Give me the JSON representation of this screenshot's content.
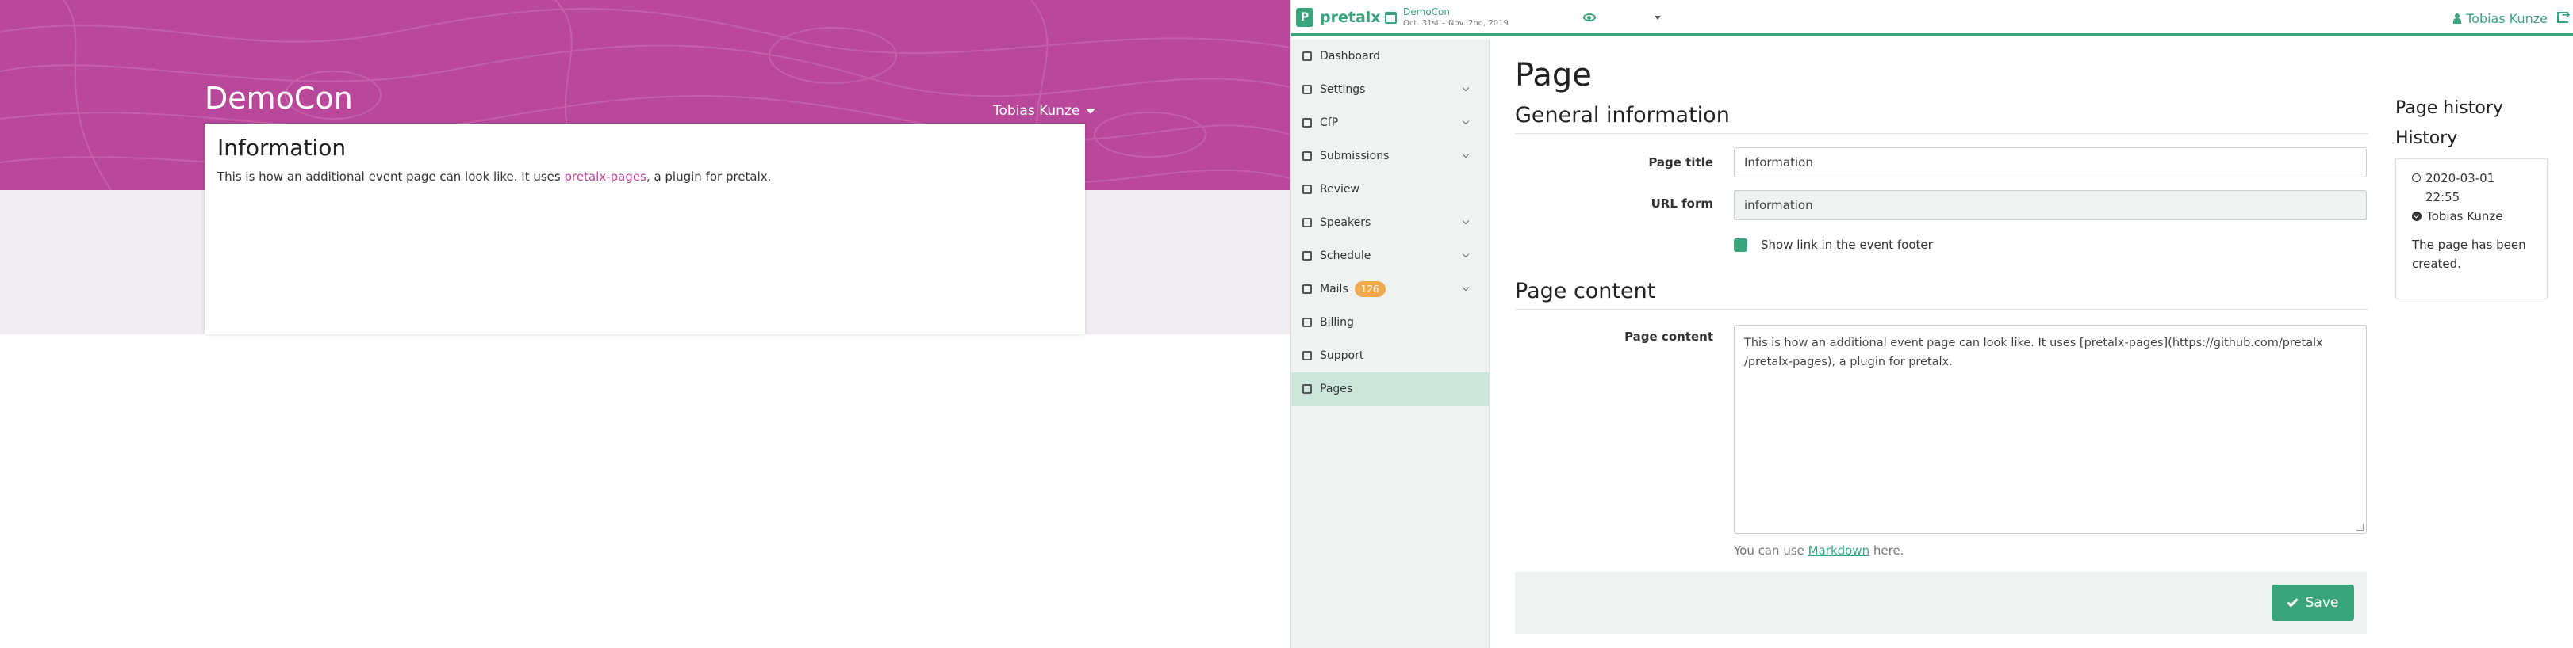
{
  "preview": {
    "event_title": "DemoCon",
    "user_name": "Tobias Kunze",
    "page_title": "Information",
    "body_before": "This is how an additional event page can look like. It uses ",
    "body_link": "pretalx-pages",
    "body_after": ", a plugin for pretalx.",
    "hero_color": "#b9479a"
  },
  "backend": {
    "brand": "pretalx",
    "event": {
      "name": "DemoCon",
      "dates": "Oct. 31st – Nov. 2nd, 2019"
    },
    "user_name": "Tobias Kunze",
    "accent_color": "#3aa57c",
    "sidebar": [
      {
        "label": "Dashboard",
        "icon": "dashboard-icon",
        "has_children": false
      },
      {
        "label": "Settings",
        "icon": "wrench-icon",
        "has_children": true
      },
      {
        "label": "CfP",
        "icon": "bullhorn-icon",
        "has_children": true
      },
      {
        "label": "Submissions",
        "icon": "sticky-note-icon",
        "has_children": true
      },
      {
        "label": "Review",
        "icon": "eye-icon",
        "has_children": false
      },
      {
        "label": "Speakers",
        "icon": "id-card-icon",
        "has_children": true
      },
      {
        "label": "Schedule",
        "icon": "calendar-icon",
        "has_children": true
      },
      {
        "label": "Mails",
        "icon": "envelope-icon",
        "has_children": true,
        "badge": "126"
      },
      {
        "label": "Billing",
        "icon": "credit-card-icon",
        "has_children": false
      },
      {
        "label": "Support",
        "icon": "support-icon",
        "has_children": false
      },
      {
        "label": "Pages",
        "icon": "file-icon",
        "has_children": false,
        "active": true
      }
    ],
    "page_heading": "Page",
    "general_heading": "General information",
    "fields": {
      "title_label": "Page title",
      "title_value": "Information",
      "url_label": "URL form",
      "url_value": "information",
      "footer_checkbox_label": "Show link in the event footer",
      "footer_checkbox_checked": true
    },
    "content_heading": "Page content",
    "content_label": "Page content",
    "content_line1": "This is how an additional event page can look like. It uses [pretalx-pages](https://github.com/pretalx",
    "content_line2": "/pretalx-pages), a plugin for pretalx.",
    "help_before": "You can use ",
    "help_link": "Markdown",
    "help_after": " here.",
    "save_label": "Save",
    "history": {
      "title": "Page history",
      "subtitle": "History",
      "timestamp": "2020-03-01 22:55",
      "author": "Tobias Kunze",
      "message": "The page has been created."
    }
  }
}
